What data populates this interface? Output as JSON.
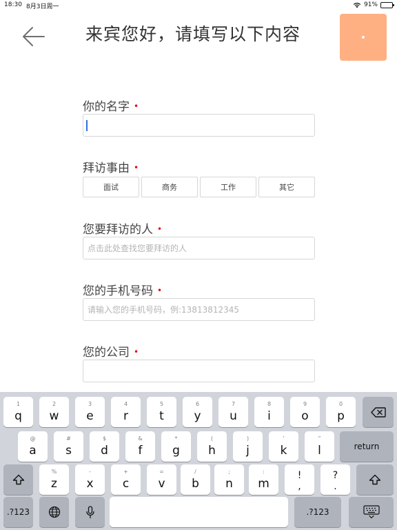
{
  "status_bar": {
    "time": "18:30",
    "date": "8月3日周一",
    "battery": "91%",
    "battery_level": 0.91
  },
  "header": {
    "back_icon": "arrow-left-icon",
    "title": "来宾您好，请填写以下内容"
  },
  "form": {
    "name": {
      "label": "你的名字",
      "required": "•",
      "value": "",
      "placeholder": ""
    },
    "purpose": {
      "label": "拜访事由",
      "required": "•",
      "options": [
        "面试",
        "商务",
        "工作",
        "其它"
      ]
    },
    "host": {
      "label": "您要拜访的人",
      "required": "•",
      "placeholder": "点击此处查找您要拜访的人"
    },
    "phone": {
      "label": "您的手机号码",
      "required": "•",
      "placeholder": "请输入您的手机号码，例:13813812345"
    },
    "company": {
      "label": "您的公司",
      "required": "•",
      "value": "",
      "placeholder": ""
    }
  },
  "keyboard": {
    "row1": [
      {
        "sub": "1",
        "main": "q"
      },
      {
        "sub": "2",
        "main": "w"
      },
      {
        "sub": "3",
        "main": "e"
      },
      {
        "sub": "4",
        "main": "r"
      },
      {
        "sub": "5",
        "main": "t"
      },
      {
        "sub": "6",
        "main": "y"
      },
      {
        "sub": "7",
        "main": "u"
      },
      {
        "sub": "8",
        "main": "i"
      },
      {
        "sub": "9",
        "main": "o"
      },
      {
        "sub": "0",
        "main": "p"
      }
    ],
    "row2": [
      {
        "sub": "@",
        "main": "a"
      },
      {
        "sub": "#",
        "main": "s"
      },
      {
        "sub": "$",
        "main": "d"
      },
      {
        "sub": "&",
        "main": "f"
      },
      {
        "sub": "*",
        "main": "g"
      },
      {
        "sub": "(",
        "main": "h"
      },
      {
        "sub": ")",
        "main": "j"
      },
      {
        "sub": "’",
        "main": "k"
      },
      {
        "sub": "”",
        "main": "l"
      }
    ],
    "row3": [
      {
        "sub": "%",
        "main": "z"
      },
      {
        "sub": "-",
        "main": "x"
      },
      {
        "sub": "+",
        "main": "c"
      },
      {
        "sub": "=",
        "main": "v"
      },
      {
        "sub": "/",
        "main": "b"
      },
      {
        "sub": ";",
        "main": "n"
      },
      {
        "sub": ":",
        "main": "m"
      }
    ],
    "punct": [
      {
        "top": "!",
        "bottom": ","
      },
      {
        "top": "?",
        "bottom": "."
      }
    ],
    "return_label": "return",
    "numbers_label": ".?123",
    "icons": {
      "delete": "backspace-icon",
      "shift": "shift-icon",
      "globe": "globe-icon",
      "mic": "microphone-icon",
      "dismiss": "keyboard-dismiss-icon"
    }
  },
  "colors": {
    "accent": "#ffb083",
    "required": "#e60012",
    "caret": "#2f6fdf",
    "keyboard_bg": "#d1d4da"
  }
}
